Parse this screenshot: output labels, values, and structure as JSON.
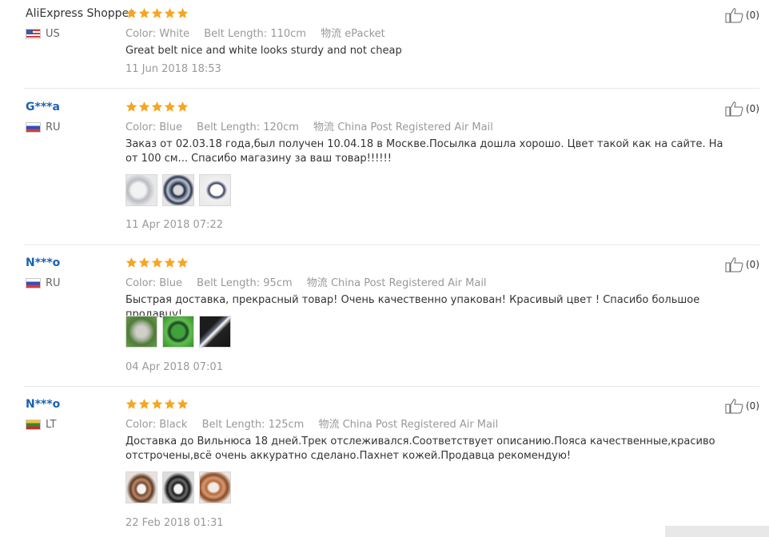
{
  "labels": {
    "color": "Color:",
    "belt_length": "Belt Length:",
    "shipping": "物流"
  },
  "reviews": [
    {
      "user": "AliExpress Shopper",
      "country": "US",
      "color": "White",
      "belt_length": "110cm",
      "shipping": "ePacket",
      "text": "Great belt nice and white looks sturdy and not cheap",
      "date": "11 Jun 2018 18:53",
      "helpful": "(0)",
      "rating": 5,
      "photos": []
    },
    {
      "user": "G***a",
      "country": "RU",
      "color": "Blue",
      "belt_length": "120cm",
      "shipping": "China Post Registered Air Mail",
      "text": "Заказ от 02.03.18 года,был получен 10.04.18 в Москве.Посылка дошла хорошо. Цвет такой как на сайте. На от 100 см... Спасибо магазину за ваш товар!!!!!!",
      "date": "11 Apr 2018 07:22",
      "helpful": "(0)",
      "rating": 5,
      "photos": [
        "photo-1",
        "photo-2",
        "photo-3"
      ]
    },
    {
      "user": "N***o",
      "country": "RU",
      "color": "Blue",
      "belt_length": "95cm",
      "shipping": "China Post Registered Air Mail",
      "text": "Быстрая доставка, прекрасный товар! Очень качественно упакован! Красивый цвет ! Спасибо большое продавцу!",
      "date": "04 Apr 2018 07:01",
      "helpful": "(0)",
      "rating": 5,
      "photos": [
        "photo-1",
        "photo-2",
        "photo-3"
      ]
    },
    {
      "user": "N***o",
      "country": "LT",
      "color": "Black",
      "belt_length": "125cm",
      "shipping": "China Post Registered Air Mail",
      "text": "Доставка до Вильнюса 18 дней.Трек отслеживался.Соответствует описанию.Пояса качественные,красиво отстрочены,всё очень аккуратно сделано.Пахнет кожей.Продавца рекомендую!",
      "date": "22 Feb 2018 01:31",
      "helpful": "(0)",
      "rating": 5,
      "photos": [
        "photo-1",
        "photo-2",
        "photo-3"
      ]
    }
  ],
  "colors": {
    "star": "#f5a623",
    "username_masked": "#1b62b5",
    "meta": "#999999"
  },
  "icons": {
    "rating": "star-icon",
    "helpful": "thumbs-up-icon"
  }
}
